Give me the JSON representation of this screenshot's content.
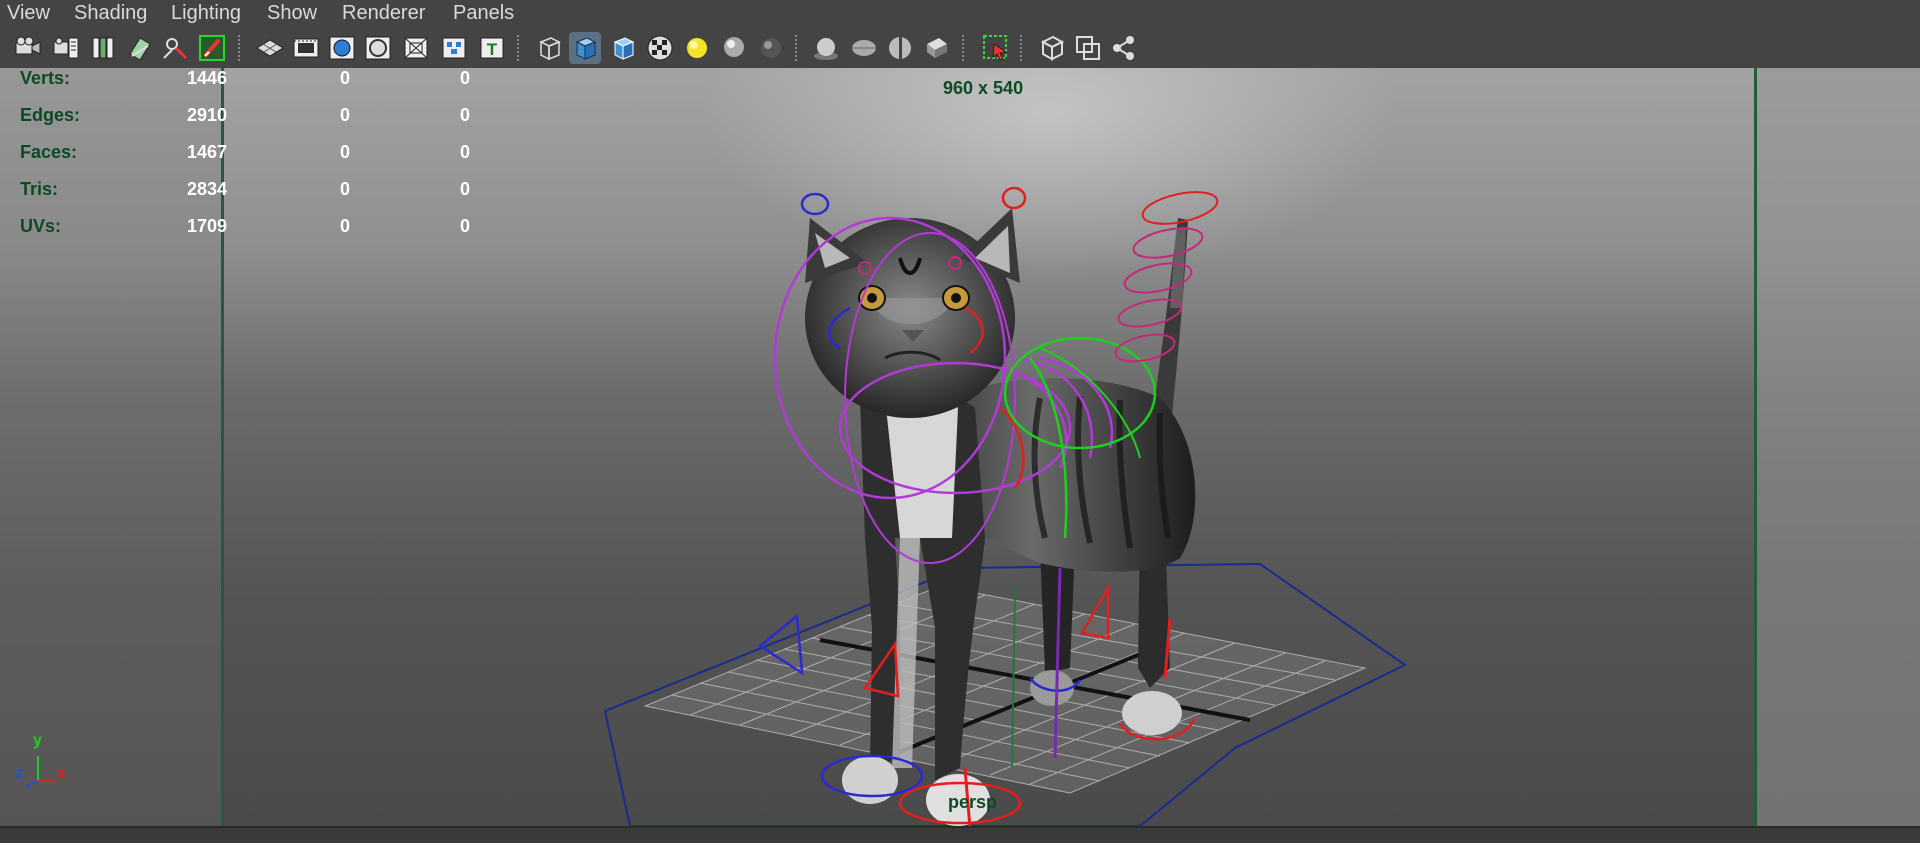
{
  "menubar": {
    "items": [
      "View",
      "Shading",
      "Lighting",
      "Show",
      "Renderer",
      "Panels"
    ]
  },
  "toolbar": {
    "icons": [
      "select-camera-icon",
      "camera-attributes-icon",
      "bookmarks-icon",
      "image-plane-icon",
      "two-d-pan-zoom-icon",
      "grease-pencil-icon",
      "grid-toggle-icon",
      "film-gate-icon",
      "resolution-gate-icon",
      "gate-mask-icon",
      "field-chart-icon",
      "safe-action-icon",
      "safe-title-icon",
      "wireframe-icon",
      "smooth-shade-icon",
      "wireframe-on-shaded-icon",
      "textured-icon",
      "use-all-lights-icon",
      "shadows-icon",
      "screen-space-ao-icon",
      "motion-blur-icon",
      "multisample-aa-icon",
      "depth-of-field-icon",
      "isolate-select-icon",
      "xray-icon",
      "xray-active-components-icon",
      "xray-joints-icon"
    ]
  },
  "hud": {
    "stats": [
      {
        "label": "Verts:",
        "values": [
          "1446",
          "0",
          "0"
        ]
      },
      {
        "label": "Edges:",
        "values": [
          "2910",
          "0",
          "0"
        ]
      },
      {
        "label": "Faces:",
        "values": [
          "1467",
          "0",
          "0"
        ]
      },
      {
        "label": "Tris:",
        "values": [
          "2834",
          "0",
          "0"
        ]
      },
      {
        "label": "UVs:",
        "values": [
          "1709",
          "0",
          "0"
        ]
      }
    ],
    "resolution": "960 x 540",
    "camera_name": "persp",
    "axis": {
      "y": "y",
      "z": "z",
      "x": "x"
    }
  },
  "colors": {
    "hud_label": "#0c4a24",
    "gate_line": "#1e5e3a",
    "axis_y": "#22cc22",
    "axis_x": "#dd2222",
    "axis_z": "#2a4bd8",
    "rig_magenta": "#b23ad6",
    "rig_red": "#e21f1f",
    "rig_blue": "#2a2ad0",
    "rig_green": "#1ed01e"
  }
}
